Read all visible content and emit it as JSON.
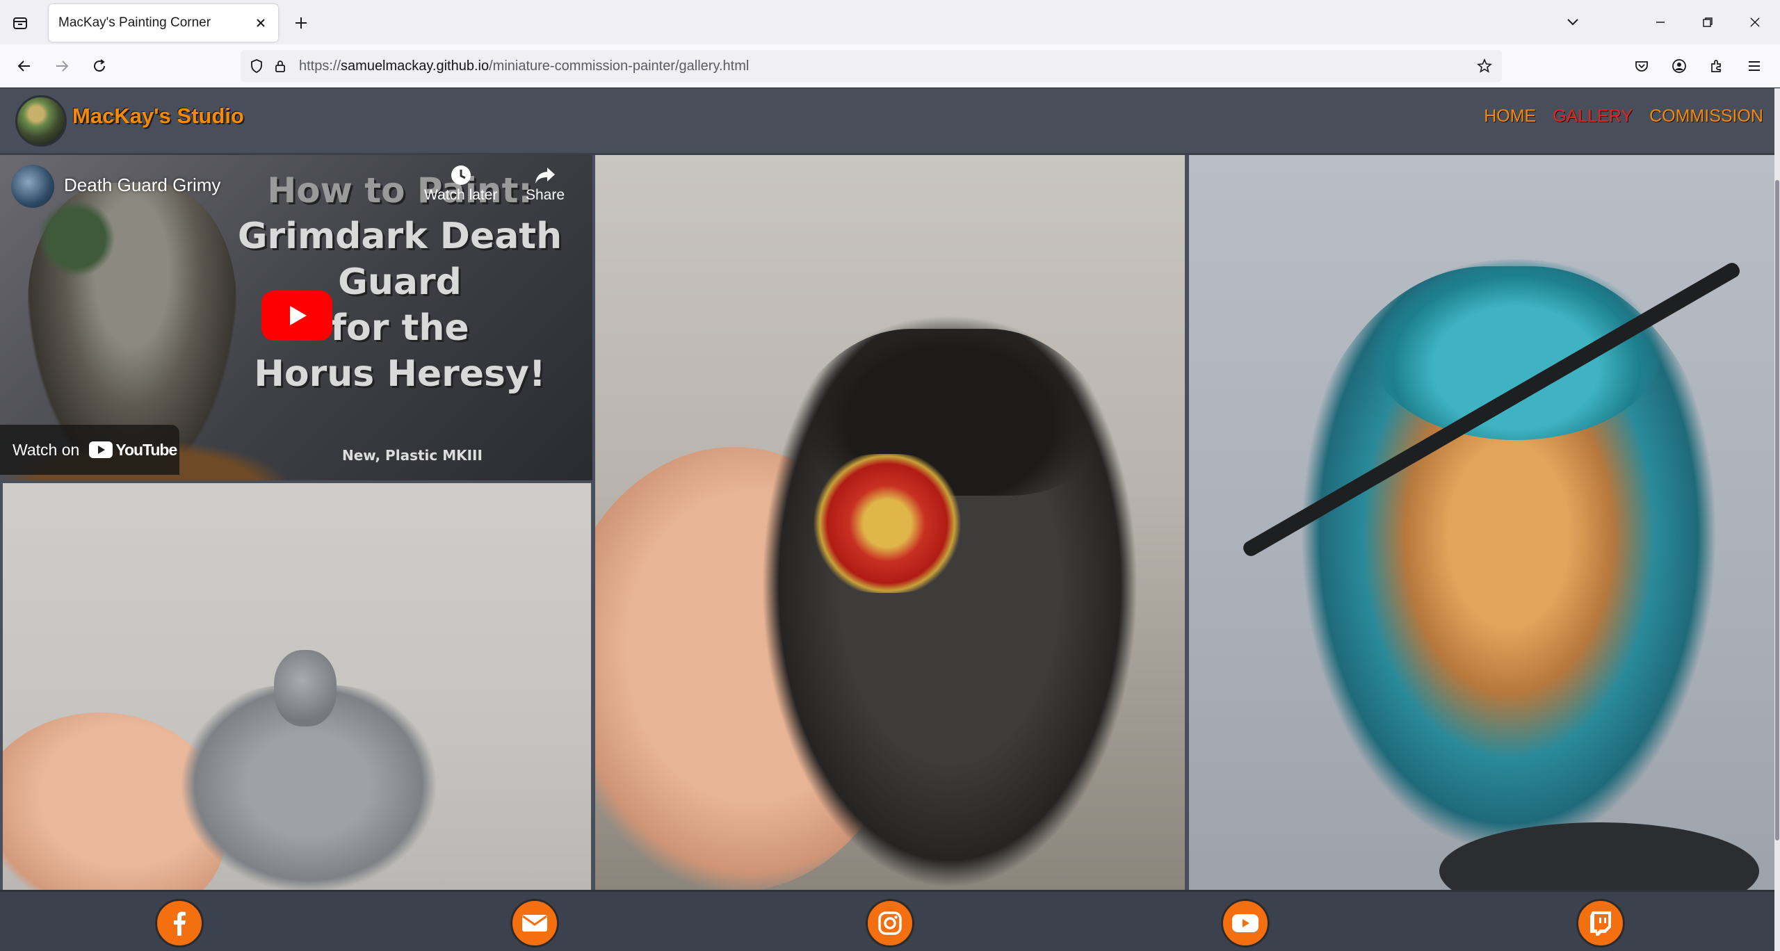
{
  "browser": {
    "tab_title": "MacKay's Painting Corner",
    "url_prefix": "https://",
    "url_domain": "samuelmackay.github.io",
    "url_path": "/miniature-commission-painter/gallery.html"
  },
  "site": {
    "logo_text": "MacKay's Studio",
    "nav": [
      {
        "label": "HOME",
        "active": false
      },
      {
        "label": "GALLERY",
        "active": true
      },
      {
        "label": "COMMISSION",
        "active": false
      }
    ],
    "accent_color": "#f58a07",
    "active_color": "#e8251f"
  },
  "video": {
    "title": "Death Guard Grimy",
    "overlay_lines": [
      "How to Paint:",
      "Grimdark Death Guard",
      "for the",
      "Horus Heresy!"
    ],
    "overlay_sub": "New, Plastic MKIII",
    "watch_later": "Watch later",
    "share": "Share",
    "watch_on": "Watch on",
    "youtube": "YouTube"
  },
  "footer": {
    "icons": [
      "facebook-icon",
      "email-icon",
      "instagram-icon",
      "youtube-icon",
      "twitch-icon"
    ]
  }
}
